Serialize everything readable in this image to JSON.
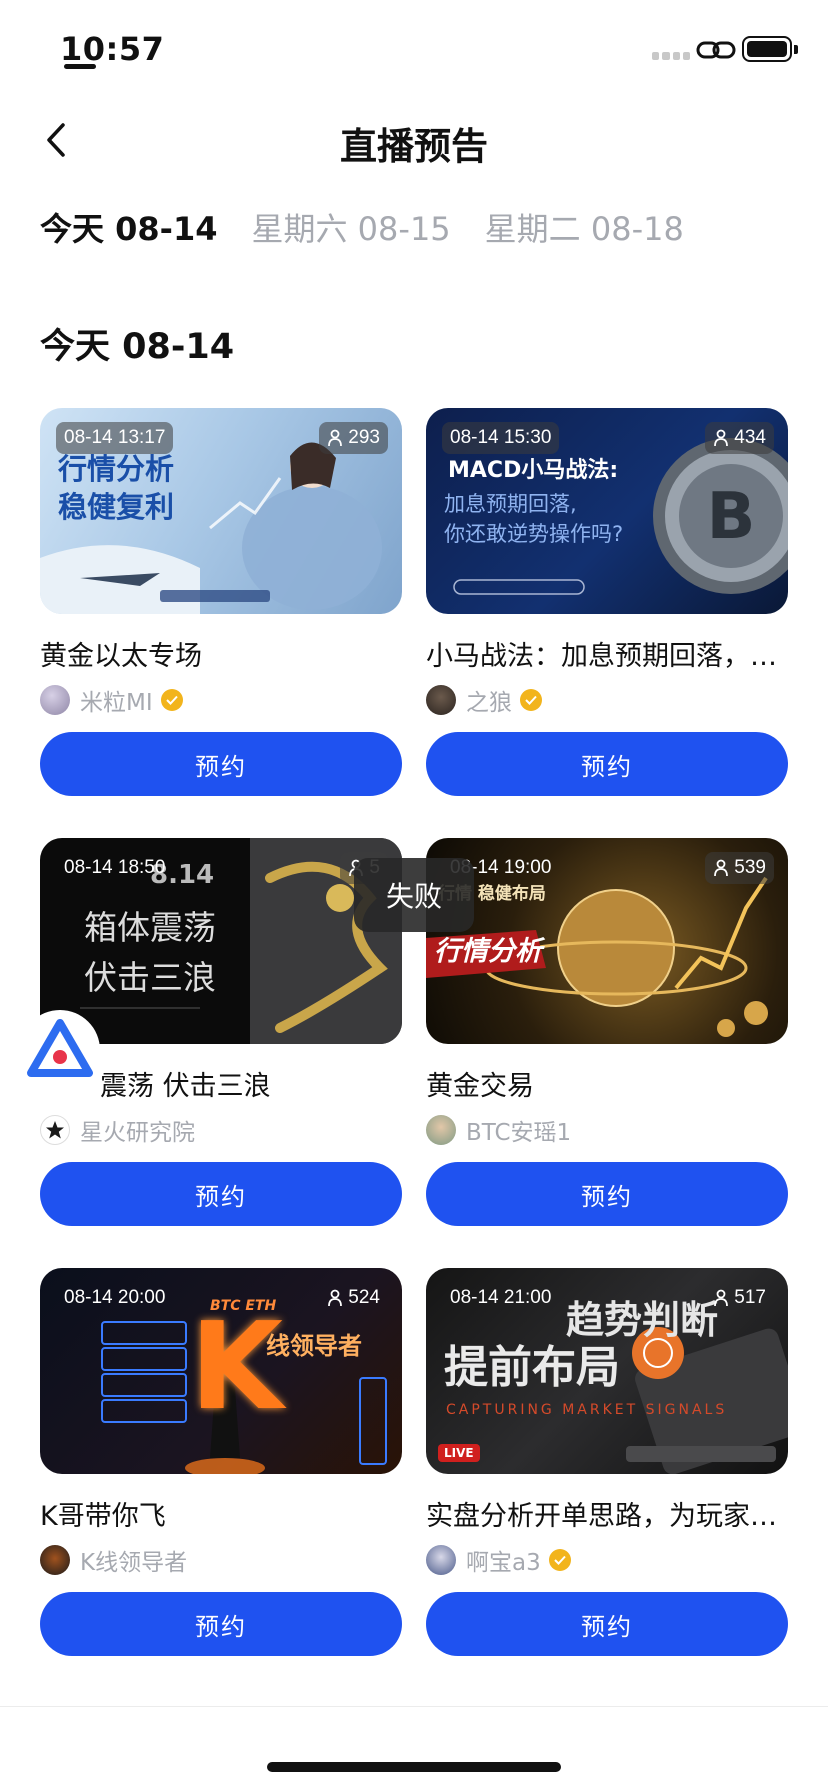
{
  "status_bar": {
    "time": "10:57"
  },
  "nav": {
    "title": "直播预告"
  },
  "tabs": [
    {
      "label": "今天 08-14",
      "active": true
    },
    {
      "label": "星期六 08-15",
      "active": false
    },
    {
      "label": "星期二 08-18",
      "active": false
    }
  ],
  "section": {
    "title": "今天 08-14"
  },
  "toast": {
    "text": "失败"
  },
  "cards": [
    {
      "time": "08-14 13:17",
      "viewers": "293",
      "thumb_lines": [
        "行情分析",
        "稳健复利"
      ],
      "thumb_tag": "",
      "title": "黄金以太专场",
      "author": "米粒MI",
      "verified": true,
      "button": "预约"
    },
    {
      "time": "08-14 15:30",
      "viewers": "434",
      "thumb_lines": [
        "MACD小马战法:",
        "加息预期回落,",
        "你还敢逆势操作吗?"
      ],
      "thumb_tag": "",
      "title": "小马战法：加息预期回落，你还敢逆势操作吗？",
      "author": "之狼",
      "verified": true,
      "button": "预约"
    },
    {
      "time": "08-14 18:50",
      "viewers": "5",
      "thumb_lines": [
        "8.14",
        "箱体震荡",
        "伏击三浪"
      ],
      "thumb_tag": "",
      "title": "震荡 伏击三浪",
      "author": "星火研究院",
      "verified": false,
      "button": "预约"
    },
    {
      "time": "08-14 19:00",
      "viewers": "539",
      "thumb_lines": [
        "行情 稳健布局",
        "行情分析"
      ],
      "thumb_tag": "",
      "title": "黄金交易",
      "author": "BTC安瑶1",
      "verified": false,
      "button": "预约"
    },
    {
      "time": "08-14 20:00",
      "viewers": "524",
      "thumb_lines": [
        "K",
        "线领导者",
        "BTC ETH"
      ],
      "thumb_tag": "",
      "title": "K哥带你飞",
      "author": "K线领导者",
      "verified": false,
      "button": "预约"
    },
    {
      "time": "08-14 21:00",
      "viewers": "517",
      "thumb_lines": [
        "趋势判断",
        "提前布局",
        "CAPTURING MARKET SIGNALS"
      ],
      "thumb_tag": "LIVE",
      "title": "实盘分析开单思路，为玩家保驾护航",
      "author": "啊宝a3",
      "verified": true,
      "button": "预约"
    }
  ],
  "colors": {
    "accent": "#1f52f0",
    "muted_text": "#a6a9b0",
    "verified": "#f2b41c"
  }
}
